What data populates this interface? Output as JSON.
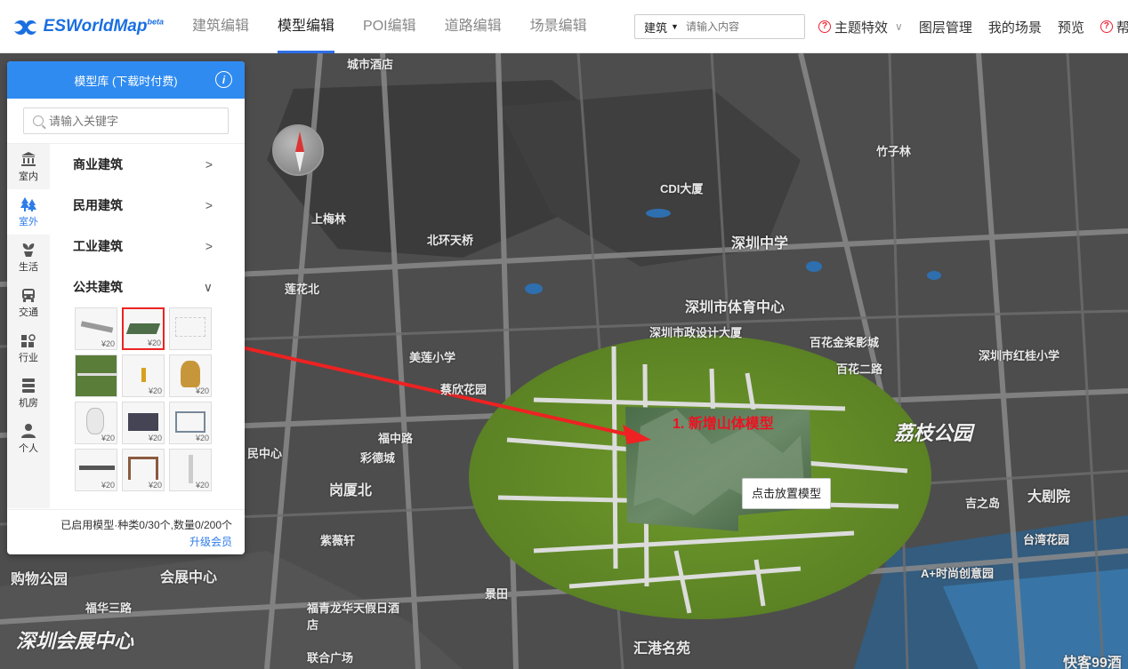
{
  "header": {
    "logo_text": "ESWorldMap",
    "logo_sup": "beta",
    "nav": [
      {
        "label": "建筑编辑",
        "active": false
      },
      {
        "label": "模型编辑",
        "active": true
      },
      {
        "label": "POI编辑",
        "active": false
      },
      {
        "label": "道路编辑",
        "active": false
      },
      {
        "label": "场景编辑",
        "active": false
      }
    ],
    "search": {
      "type": "建筑",
      "placeholder": "请输入内容"
    },
    "menu": {
      "theme": "主题特效",
      "layers": "图层管理",
      "scenes": "我的场景",
      "preview": "预览",
      "help": "帮"
    }
  },
  "panel": {
    "title": "模型库 (下载时付费)",
    "search_placeholder": "请输入关键字",
    "tabs": [
      {
        "label": "室内",
        "icon": "building-icon",
        "active": false
      },
      {
        "label": "室外",
        "icon": "tree-icon",
        "active": true
      },
      {
        "label": "生活",
        "icon": "plant-icon",
        "active": false
      },
      {
        "label": "交通",
        "icon": "bus-icon",
        "active": false
      },
      {
        "label": "行业",
        "icon": "industry-icon",
        "active": false
      },
      {
        "label": "机房",
        "icon": "server-icon",
        "active": false
      },
      {
        "label": "个人",
        "icon": "person-icon",
        "active": false
      }
    ],
    "categories": [
      {
        "label": "商业建筑",
        "expanded": false
      },
      {
        "label": "民用建筑",
        "expanded": false
      },
      {
        "label": "工业建筑",
        "expanded": false
      },
      {
        "label": "公共建筑",
        "expanded": true
      }
    ],
    "models": [
      {
        "price": "¥20",
        "selected": false
      },
      {
        "price": "¥20",
        "selected": true
      },
      {
        "price": "",
        "selected": false
      },
      {
        "price": "",
        "selected": false
      },
      {
        "price": "¥20",
        "selected": false
      },
      {
        "price": "¥20",
        "selected": false
      },
      {
        "price": "¥20",
        "selected": false
      },
      {
        "price": "¥20",
        "selected": false
      },
      {
        "price": "¥20",
        "selected": false
      },
      {
        "price": "¥20",
        "selected": false
      },
      {
        "price": "¥20",
        "selected": false
      },
      {
        "price": "¥20",
        "selected": false
      }
    ],
    "footer_text": "已启用模型·种类0/30个,数量0/200个",
    "upgrade": "升级会员"
  },
  "map": {
    "place_tip": "点击放置模型",
    "annotation": "1. 新增山体模型",
    "labels": [
      "城市酒店",
      "深圳中学",
      "深圳市体育中心",
      "深圳市政设计大厦",
      "百花金桨影城",
      "美莲小学",
      "蔡欣花园",
      "福中路",
      "彩德城",
      "民中心",
      "岗厦北",
      "紫薇轩",
      "购物公园",
      "会展中心",
      "福华三路",
      "深圳会展中心",
      "福青龙华天假日酒店",
      "联合广场",
      "汇港名苑",
      "荔枝公园",
      "大剧院",
      "吉之岛",
      "台湾花园",
      "A+时尚创意园",
      "快客99酒",
      "莲花北",
      "上梅林",
      "竹子林",
      "景田",
      "北环天桥",
      "CDI大厦",
      "深圳市红桂小学",
      "百花二路"
    ]
  }
}
